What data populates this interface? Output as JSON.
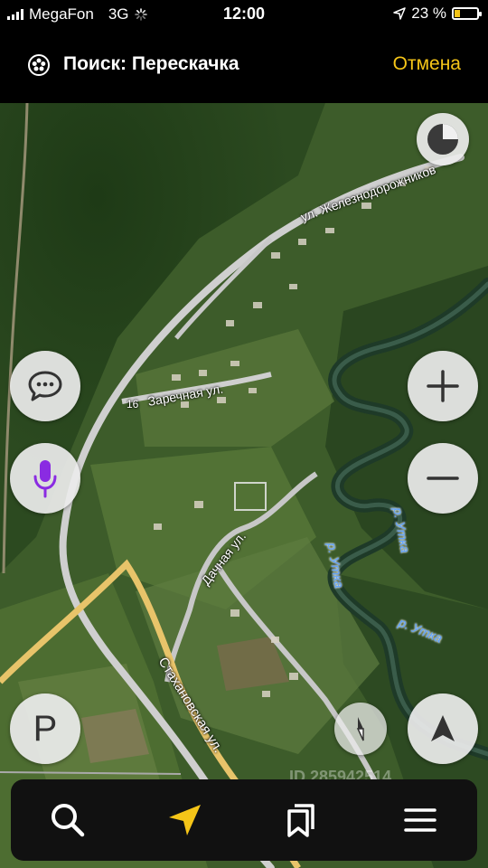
{
  "status_bar": {
    "carrier": "MegaFon",
    "network": "3G",
    "time": "12:00",
    "battery_percent": "23 %",
    "battery_level": 0.23,
    "battery_color": "#f5c518"
  },
  "search": {
    "title": "Поиск: Перескачка",
    "cancel_label": "Отмена",
    "accent_color": "#f5c518",
    "icon": "aperture-icon"
  },
  "map": {
    "street_labels": [
      "ул. Железнодорожников",
      "Заречная ул.",
      "Дачная ул.",
      "Стахановская ул."
    ],
    "house_number": "16",
    "river_labels": [
      "р. Утка",
      "р. Утка",
      "р. Утка"
    ],
    "watermark": "ID 285942514"
  },
  "controls": {
    "compass": "compass-icon",
    "chat": "chat-bubble-icon",
    "voice": "microphone-icon",
    "zoom_in": "plus-icon",
    "zoom_out": "minus-icon",
    "parking": "P",
    "north": "north-arrow-icon",
    "locate": "navigation-arrow-icon"
  },
  "bottom_nav": [
    {
      "name": "search",
      "icon": "search-icon"
    },
    {
      "name": "navigator",
      "icon": "navigator-arrow-icon"
    },
    {
      "name": "bookmarks",
      "icon": "bookmarks-icon"
    },
    {
      "name": "menu",
      "icon": "menu-icon"
    }
  ]
}
